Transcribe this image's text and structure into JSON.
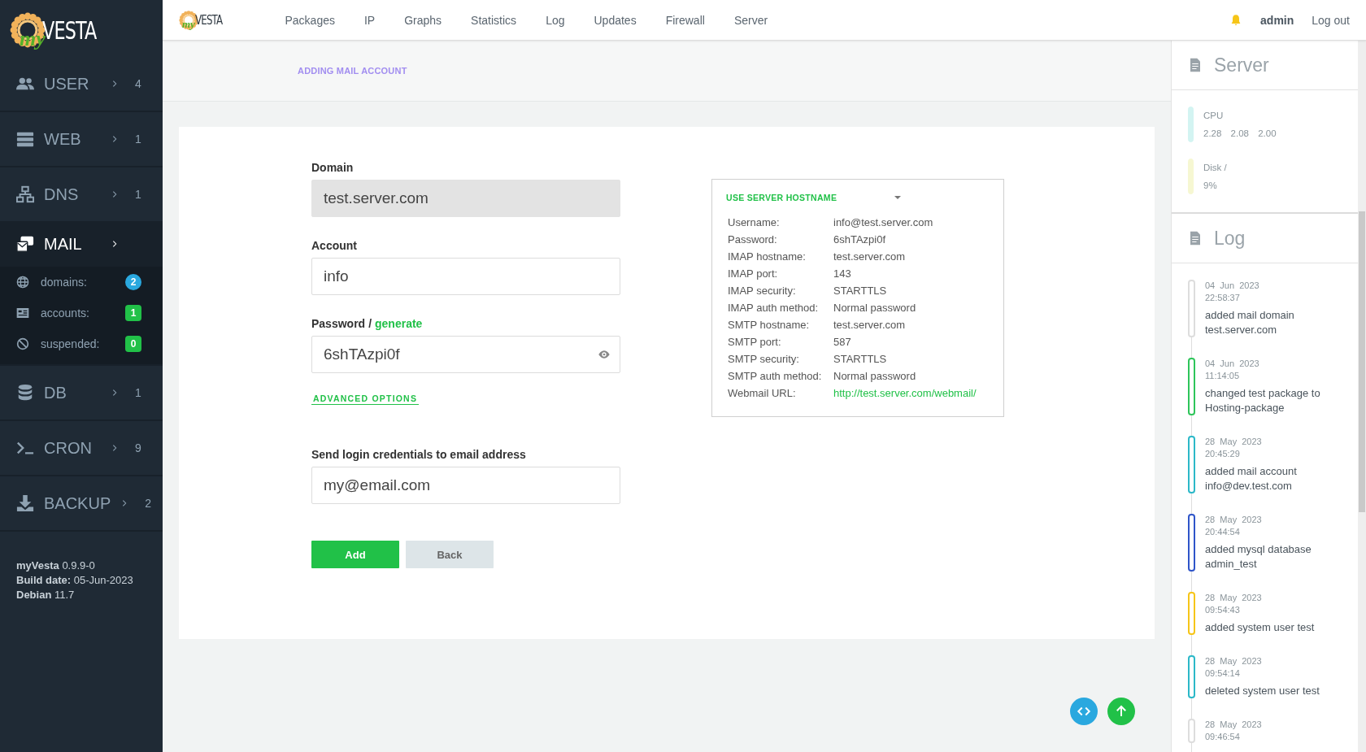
{
  "sidebar": {
    "logo": {
      "prefix": "my",
      "name": "VESTA"
    },
    "items": [
      {
        "kind": "user",
        "label": "USER",
        "count": "4",
        "selected": false
      },
      {
        "kind": "web",
        "label": "WEB",
        "count": "1",
        "selected": false
      },
      {
        "kind": "dns",
        "label": "DNS",
        "count": "1",
        "selected": false
      },
      {
        "kind": "mail",
        "label": "MAIL",
        "selected": true,
        "children": [
          {
            "kind": "globe",
            "label": "domains:",
            "count": "2",
            "color": "#2aa8df"
          },
          {
            "kind": "card",
            "label": "accounts:",
            "count": "1",
            "color": "#21c148"
          },
          {
            "kind": "ban",
            "label": "suspended:",
            "count": "0",
            "color": "#21c148"
          }
        ]
      },
      {
        "kind": "db",
        "label": "DB",
        "count": "1",
        "selected": false
      },
      {
        "kind": "cron",
        "label": "CRON",
        "count": "9",
        "selected": false
      },
      {
        "kind": "backup",
        "label": "BACKUP",
        "count": "2",
        "selected": false
      }
    ],
    "footer": [
      {
        "label": "myVesta",
        "value": "0.9.9-0"
      },
      {
        "label": "Build date:",
        "value": "05-Jun-2023"
      },
      {
        "label": "Debian",
        "value": "11.7"
      }
    ]
  },
  "topbar": {
    "logo": {
      "prefix": "my",
      "name": "VESTA"
    },
    "nav": [
      "Packages",
      "IP",
      "Graphs",
      "Statistics",
      "Log",
      "Updates",
      "Firewall",
      "Server"
    ],
    "user": "admin",
    "logout": "Log out"
  },
  "breadcrumb": "ADDING MAIL ACCOUNT",
  "form": {
    "fields": [
      {
        "kind": "text",
        "label": "Domain",
        "value": "test.server.com",
        "disabled": true
      },
      {
        "kind": "text",
        "label": "Account",
        "value": "info",
        "disabled": false
      },
      {
        "kind": "password",
        "label": "Password",
        "separator": "/",
        "link": "generate",
        "value": "6shTAzpi0f",
        "disabled": false
      }
    ],
    "advanced_options": "ADVANCED OPTIONS",
    "notify_field": {
      "label": "Send login credentials to email address",
      "value": "my@email.com"
    },
    "buttons": [
      {
        "kind": "primary",
        "label": "Add"
      },
      {
        "kind": "secondary",
        "label": "Back"
      }
    ]
  },
  "info_box": {
    "title": "USE SERVER HOSTNAME",
    "rows": [
      {
        "label": "Username:",
        "value": "info@test.server.com",
        "kind": "text"
      },
      {
        "label": "Password:",
        "value": "6shTAzpi0f",
        "kind": "text"
      },
      {
        "label": "IMAP hostname:",
        "value": "test.server.com",
        "kind": "text"
      },
      {
        "label": "IMAP port:",
        "value": "143",
        "kind": "text"
      },
      {
        "label": "IMAP security:",
        "value": "STARTTLS",
        "kind": "text"
      },
      {
        "label": "IMAP auth method:",
        "value": "Normal password",
        "kind": "text"
      },
      {
        "label": "SMTP hostname:",
        "value": "test.server.com",
        "kind": "text"
      },
      {
        "label": "SMTP port:",
        "value": "587",
        "kind": "text"
      },
      {
        "label": "SMTP security:",
        "value": "STARTTLS",
        "kind": "text"
      },
      {
        "label": "SMTP auth method:",
        "value": "Normal password",
        "kind": "text"
      },
      {
        "label": "Webmail URL:",
        "value": "http://test.server.com/webmail/",
        "kind": "link"
      }
    ]
  },
  "server_panel": {
    "title": "Server",
    "stats": [
      {
        "label": "CPU",
        "values": [
          "2.28",
          "2.08",
          "2.00"
        ],
        "color": "#d3f4f2"
      },
      {
        "label": "Disk /",
        "values": [
          "9%"
        ],
        "color": "#f6f7d2"
      }
    ]
  },
  "log_panel": {
    "title": "Log",
    "entries": [
      {
        "date": "04  Jun  2023",
        "time": "22:58:37",
        "text": "added mail domain test.server.com",
        "color": "#dddddd"
      },
      {
        "date": "04  Jun  2023",
        "time": "11:14:05",
        "text": "changed test package to Hosting-package",
        "color": "#2ec55a"
      },
      {
        "date": "28  May  2023",
        "time": "20:45:29",
        "text": "added mail account info@dev.test.com",
        "color": "#2bb8c8"
      },
      {
        "date": "28  May  2023",
        "time": "20:44:54",
        "text": "added mysql database admin_test",
        "color": "#2f55c9"
      },
      {
        "date": "28  May  2023",
        "time": "09:54:43",
        "text": "added system user test",
        "color": "#f6c518"
      },
      {
        "date": "28  May  2023",
        "time": "09:54:14",
        "text": "deleted system user test",
        "color": "#2bb8c8"
      },
      {
        "date": "28  May  2023",
        "time": "09:46:54",
        "color": "#dddddd"
      }
    ]
  }
}
